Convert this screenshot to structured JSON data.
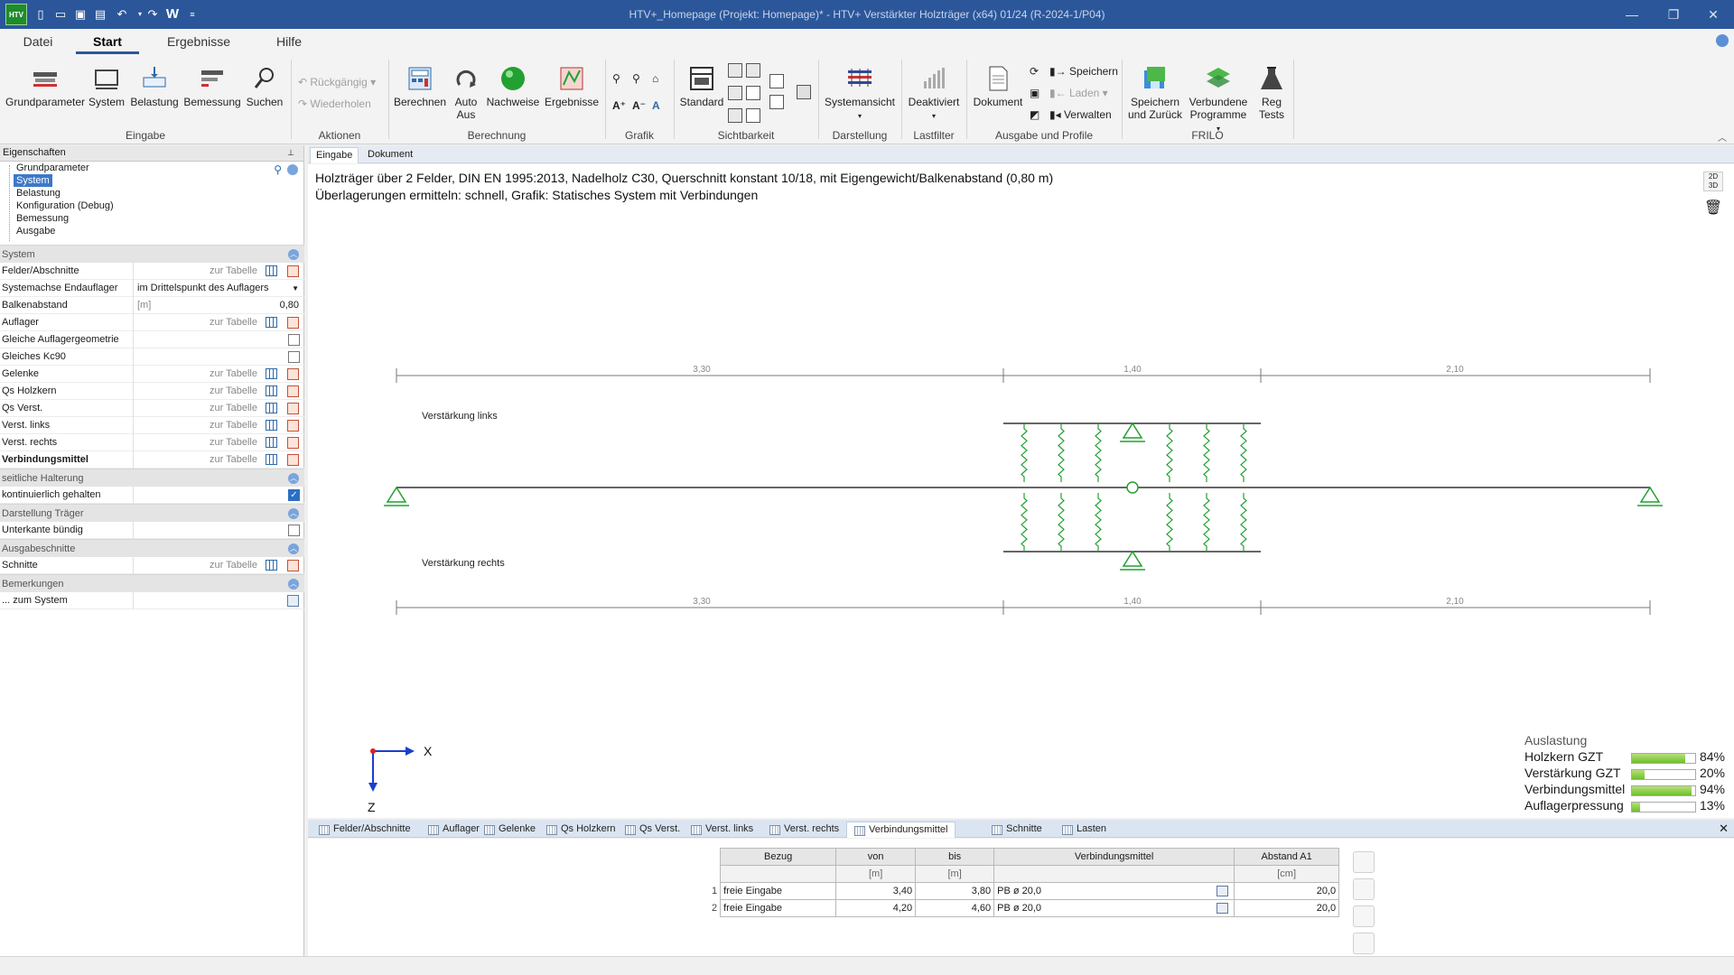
{
  "titlebar": {
    "logo": "HTV",
    "title": "HTV+_Homepage (Projekt: Homepage)* - HTV+ Verstärkter Holzträger (x64) 01/24 (R-2024-1/P04)",
    "quick_access_word": "W"
  },
  "menu": {
    "tabs": [
      "Datei",
      "Start",
      "Ergebnisse",
      "Hilfe"
    ],
    "active": "Start"
  },
  "ribbon": {
    "groups": {
      "eingabe": "Eingabe",
      "aktionen": "Aktionen",
      "berechnung": "Berechnung",
      "grafik": "Grafik",
      "sichtbarkeit": "Sichtbarkeit",
      "darstellung": "Darstellung",
      "lastfilter": "Lastfilter",
      "ausgabe": "Ausgabe und Profile",
      "frilo": "FRILO"
    },
    "buttons": {
      "grundparameter": "Grundparameter",
      "system": "System",
      "belastung": "Belastung",
      "bemessung": "Bemessung",
      "suchen": "Suchen",
      "rueckgaengig": "Rückgängig",
      "wiederholen": "Wiederholen",
      "berechnen": "Berechnen",
      "auto": "Auto",
      "aus": "Aus",
      "nachweise": "Nachweise",
      "ergebnisse": "Ergebnisse",
      "standard": "Standard",
      "systemansicht": "Systemansicht",
      "deaktiviert": "Deaktiviert",
      "dokument": "Dokument",
      "speichern": "Speichern",
      "laden": "Laden",
      "verwalten": "Verwalten",
      "speichern_zurueck_1": "Speichern",
      "speichern_zurueck_2": "und Zurück",
      "verbundene_1": "Verbundene",
      "verbundene_2": "Programme",
      "reg_1": "Reg",
      "reg_2": "Tests"
    }
  },
  "left_panel": {
    "header": "Eigenschaften",
    "tree": [
      "Grundparameter",
      "System",
      "Belastung",
      "Konfiguration (Debug)",
      "Bemessung",
      "Ausgabe"
    ],
    "tree_selected": "System",
    "zur_tabelle": "zur Tabelle",
    "sections": {
      "system": "System",
      "seitliche": "seitliche Halterung",
      "darstellung": "Darstellung Träger",
      "ausgabe": "Ausgabeschnitte",
      "bemerkungen": "Bemerkungen"
    },
    "rows": {
      "felder": "Felder/Abschnitte",
      "systemachse": "Systemachse Endauflager",
      "systemachse_value": "im Drittelspunkt des Auflagers",
      "balkenabstand": "Balkenabstand",
      "balkenabstand_unit": "[m]",
      "balkenabstand_value": "0,80",
      "auflager": "Auflager",
      "gleiche": "Gleiche Auflagergeometrie",
      "kc90": "Gleiches Kc90",
      "gelenke": "Gelenke",
      "qs_holzkern": "Qs Holzkern",
      "qs_verst": "Qs Verst.",
      "verst_links": "Verst. links",
      "verst_rechts": "Verst. rechts",
      "verbindungsmittel": "Verbindungsmittel",
      "kontinuierlich": "kontinuierlich gehalten",
      "unterkante": "Unterkante bündig",
      "schnitte": "Schnitte",
      "zum_system": "... zum System"
    }
  },
  "doc_tabs": [
    "Eingabe",
    "Dokument"
  ],
  "canvas": {
    "desc_line1": "Holzträger über 2 Felder, DIN EN 1995:2013, Nadelholz C30, Querschnitt konstant 10/18, mit Eigengewicht/Balkenabstand (0,80 m)",
    "desc_line2": "Überlagerungen ermitteln: schnell, Grafik: Statisches System mit Verbindungen",
    "view_2d3d": "2D 3D",
    "dims_top": [
      "3,30",
      "1,40",
      "2,10"
    ],
    "dims_bottom": [
      "3,30",
      "1,40",
      "2,10"
    ],
    "label_links": "Verstärkung links",
    "label_rechts": "Verstärkung rechts",
    "axis_x": "X",
    "axis_z": "Z"
  },
  "utilization": {
    "title": "Auslastung",
    "items": [
      {
        "label": "Holzkern GZT",
        "value": 0.84,
        "text": "84%"
      },
      {
        "label": "Verstärkung GZT",
        "value": 0.2,
        "text": "20%"
      },
      {
        "label": "Verbindungsmittel",
        "value": 0.94,
        "text": "94%"
      },
      {
        "label": "Auflagerpressung",
        "value": 0.13,
        "text": "13%"
      }
    ]
  },
  "bottom_tabs": [
    "Felder/Abschnitte",
    "Auflager",
    "Gelenke",
    "Qs Holzkern",
    "Qs Verst.",
    "Verst. links",
    "Verst. rechts",
    "Verbindungsmittel",
    "Schnitte",
    "Lasten"
  ],
  "bottom_tab_active": "Verbindungsmittel",
  "table": {
    "headers": [
      "Bezug",
      "von",
      "bis",
      "Verbindungsmittel",
      "Abstand A1"
    ],
    "units": [
      "",
      "[m]",
      "[m]",
      "",
      "[cm]"
    ],
    "rows": [
      {
        "n": "1",
        "bezug": "freie Eingabe",
        "von": "3,40",
        "bis": "3,80",
        "vm": "PB ø 20,0",
        "a1": "20,0"
      },
      {
        "n": "2",
        "bezug": "freie Eingabe",
        "von": "4,20",
        "bis": "4,60",
        "vm": "PB ø 20,0",
        "a1": "20,0"
      }
    ]
  }
}
